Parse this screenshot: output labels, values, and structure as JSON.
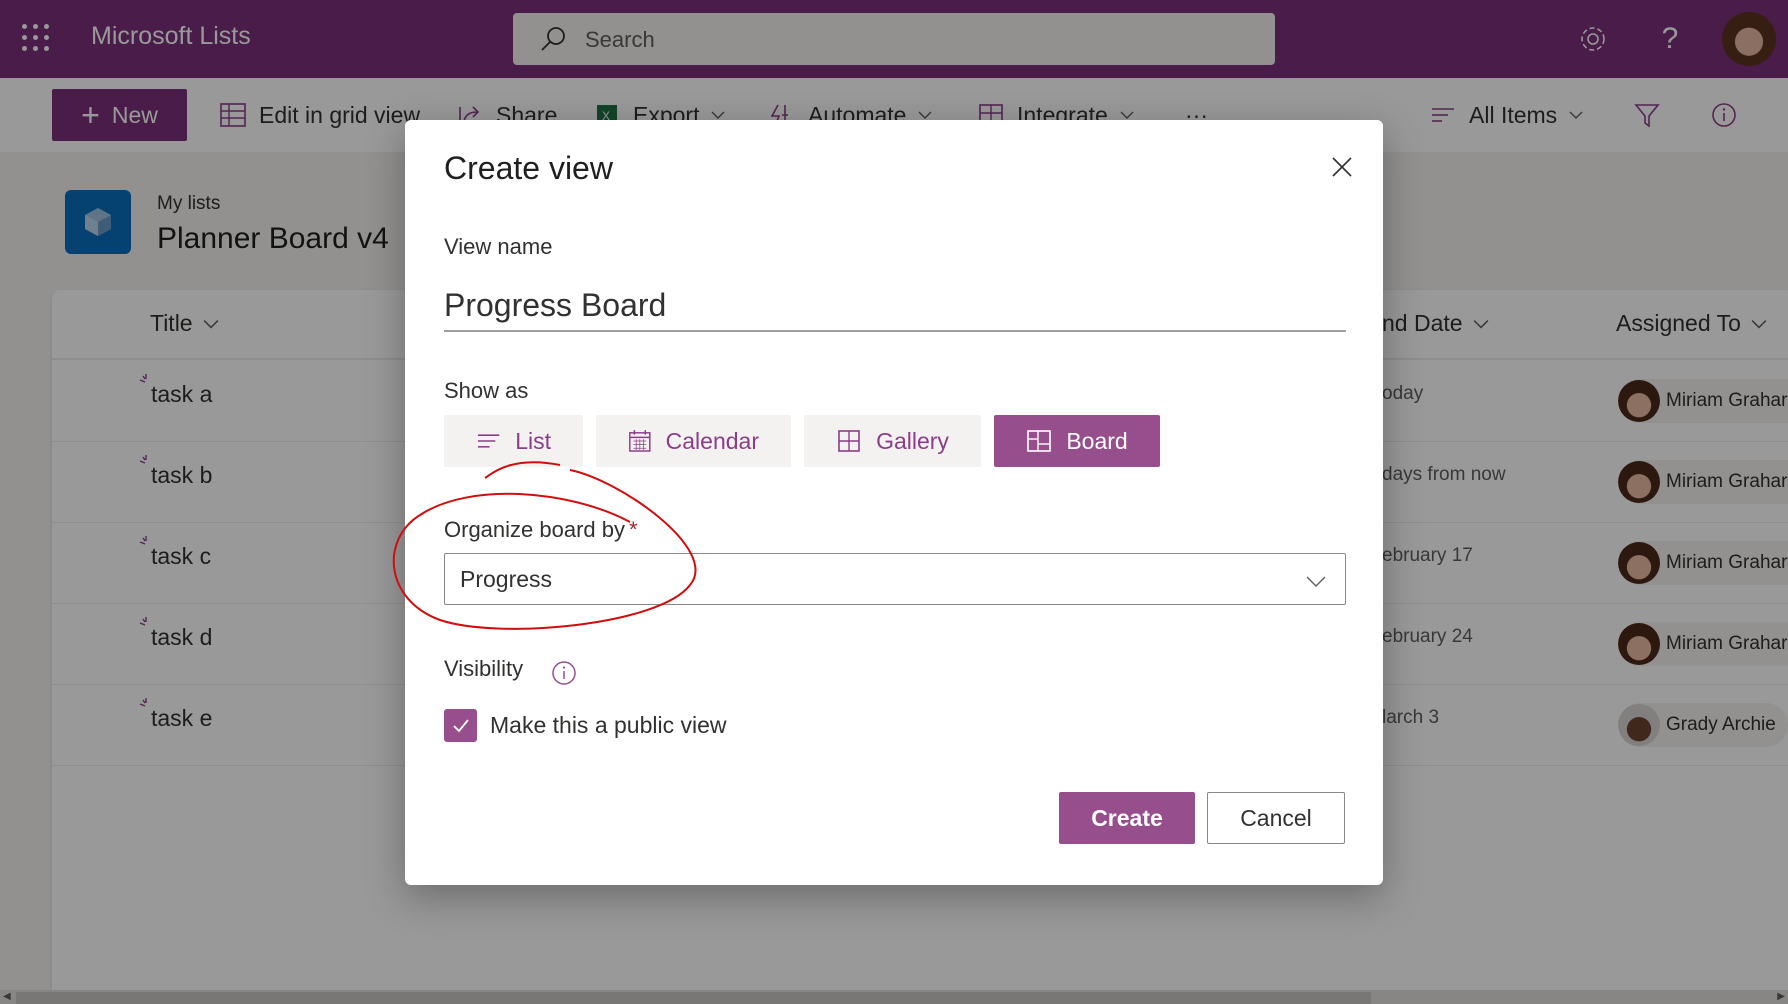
{
  "suite_header": {
    "app_name": "Microsoft Lists",
    "search_placeholder": "Search",
    "icons": [
      "app-launcher-icon",
      "search-icon",
      "settings-gear-icon",
      "help-question-icon",
      "user-avatar"
    ]
  },
  "command_bar": {
    "new_label": "New",
    "edit_grid_label": "Edit in grid view",
    "share_label": "Share",
    "export_label": "Export",
    "automate_label": "Automate",
    "integrate_label": "Integrate",
    "more_label": "···",
    "view_selector_label": "All Items",
    "icons": [
      "plus-icon",
      "grid-icon",
      "share-icon",
      "excel-icon",
      "automate-icon",
      "integrate-icon",
      "more-icon",
      "view-list-icon",
      "filter-icon",
      "info-icon"
    ]
  },
  "list": {
    "breadcrumb": "My lists",
    "title": "Planner Board v4",
    "columns": [
      {
        "label": "Title"
      },
      {
        "label": "nd Date"
      },
      {
        "label": "Assigned To"
      }
    ],
    "rows": [
      {
        "title": "task a",
        "date": "oday",
        "assigned": "Miriam Grahar",
        "avatar": "miriam"
      },
      {
        "title": "task b",
        "date": "days from now",
        "assigned": "Miriam Grahar",
        "avatar": "miriam"
      },
      {
        "title": "task c",
        "date": "ebruary 17",
        "assigned": "Miriam Grahar",
        "avatar": "miriam"
      },
      {
        "title": "task d",
        "date": "ebruary 24",
        "assigned": "Miriam Grahar",
        "avatar": "miriam"
      },
      {
        "title": "task e",
        "date": "larch 3",
        "assigned": "Grady Archie",
        "avatar": "grady"
      }
    ]
  },
  "dialog": {
    "title": "Create view",
    "view_name_label": "View name",
    "view_name_value": "Progress Board",
    "show_as_label": "Show as",
    "view_types": [
      {
        "label": "List",
        "icon": "list-icon",
        "selected": false
      },
      {
        "label": "Calendar",
        "icon": "calendar-icon",
        "selected": false
      },
      {
        "label": "Gallery",
        "icon": "gallery-icon",
        "selected": false
      },
      {
        "label": "Board",
        "icon": "board-icon",
        "selected": true
      }
    ],
    "organize_label": "Organize board by",
    "required_marker": "*",
    "organize_value": "Progress",
    "visibility_label": "Visibility",
    "public_view_label": "Make this a public view",
    "public_view_checked": true,
    "create_label": "Create",
    "cancel_label": "Cancel"
  },
  "colors": {
    "suite_bar": "#7a2f7c",
    "accent": "#974e8d",
    "annotation": "#d10d0d"
  }
}
